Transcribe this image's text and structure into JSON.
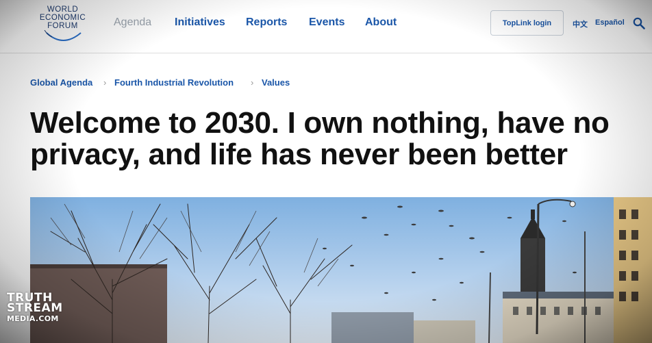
{
  "header": {
    "logo": {
      "lines": [
        "WORLD",
        "ECONOMIC",
        "FORUM"
      ]
    },
    "nav": [
      {
        "label": "Agenda"
      },
      {
        "label": "Initiatives"
      },
      {
        "label": "Reports"
      },
      {
        "label": "Events"
      },
      {
        "label": "About"
      }
    ],
    "toplink_label": "TopLink login",
    "lang_zh": "中文",
    "lang_es": "Español",
    "search_icon": "search-icon"
  },
  "breadcrumb": [
    "Global Agenda",
    "Fourth Industrial Revolution",
    "Values"
  ],
  "article": {
    "title": "Welcome to 2030. I own nothing, have no privacy, and life has never been better"
  },
  "watermark": [
    "TRUTH",
    "STREAM",
    "MEDIA.COM"
  ],
  "colors": {
    "brand_blue": "#1a56a8",
    "logo_navy": "#1d3a6e",
    "muted_nav": "#9aa3ad",
    "sky": "#8fb9e3"
  }
}
